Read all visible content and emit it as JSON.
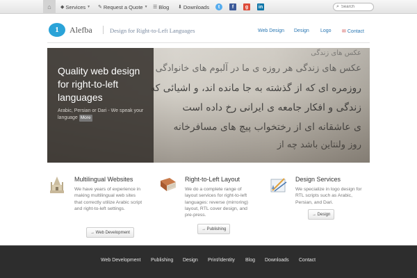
{
  "topbar": {
    "home_icon": "home-icon",
    "services_label": "Services",
    "quote_label": "Request a Quote",
    "blog_label": "Blog",
    "downloads_label": "Downloads",
    "social": [
      "twitter-icon",
      "facebook-icon",
      "google-plus-icon",
      "linkedin-icon"
    ],
    "search_placeholder": "Search"
  },
  "header": {
    "logo_name": "Alefba",
    "tagline": "Design for Right-to-Left Languages",
    "nav": {
      "web_design": "Web Design",
      "design": "Design",
      "logo": "Logo",
      "contact": "Contact"
    }
  },
  "hero": {
    "title": "Quality web design for right-to-left languages",
    "text": "Arabic, Persian or Dari - We speak your language",
    "more_label": "More"
  },
  "features": [
    {
      "title": "Multilingual Websites",
      "text": "We have years of experience in making multilingual web sites that correctly utilize Arabic script and right-to-left settings.",
      "button": "→ Web Development",
      "icon": "monument-icon"
    },
    {
      "title": "Right-to-Left Layout",
      "text": "We do a complete range of layout services for right-to-left languages: reverse (mirroring) layout, RTL cover design, and pre-press.",
      "button": "→ Publishing",
      "icon": "book-icon"
    },
    {
      "title": "Design Services",
      "text": "We specialize in logo design for RTL scripts such as Arabic, Persian, and Dari.",
      "button": "→ Design",
      "icon": "design-tools-icon"
    }
  ],
  "footer": {
    "links": [
      "Web Development",
      "Publishing",
      "Design",
      "Print/Identity",
      "Blog",
      "Downloads",
      "Contact"
    ]
  },
  "colors": {
    "accent": "#2aa3d8",
    "link": "#2a77b3",
    "footer_bg": "#2d2d2d"
  }
}
